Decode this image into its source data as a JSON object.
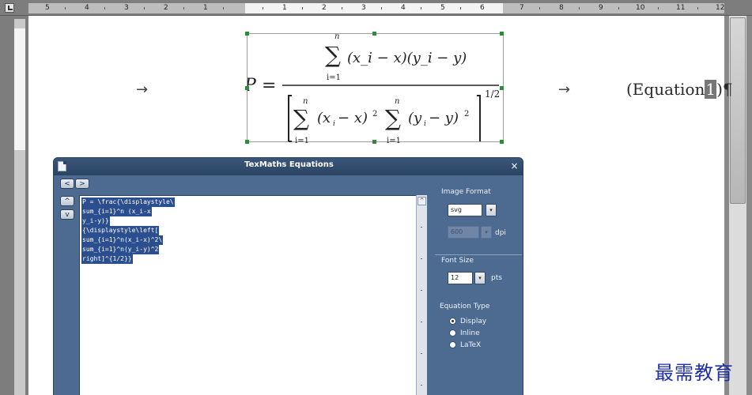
{
  "ruler": {
    "numbers_left": [
      "5",
      "4",
      "3",
      "2",
      "1"
    ],
    "numbers_center": [
      "1",
      "2",
      "3",
      "4",
      "5",
      "6"
    ],
    "numbers_right": [
      "7",
      "8",
      "9",
      "10",
      "11",
      "12"
    ]
  },
  "document": {
    "arrow_symbol": "→",
    "equation_label_prefix": "(Equation",
    "equation_label_number": "1",
    "equation_label_suffix": ")",
    "pilcrow": "¶"
  },
  "equation": {
    "lhs": "P",
    "upper_limit": "n",
    "lower_limit": "i=1",
    "numerator_terms": "(x_i − x)(y_i − y)",
    "exponent": "1/2"
  },
  "dialog": {
    "title": "TexMaths Equations",
    "close_glyph": "×",
    "nav_back_glyph": "<",
    "nav_forward_glyph": ">",
    "nav_up_glyph": "^",
    "nav_down_glyph": "v",
    "code_lines": [
      "P = \\frac{\\displaystyle\\",
      "sum_{i=1}^n (x_i-x",
      "y_i-y)}",
      "{\\displaystyle\\left[",
      "sum_{i=1}^n(x_i-x)^2\\",
      "sum_{i=1}^n(y_i-y)^2",
      "right]^{1/2}}"
    ],
    "image_format": {
      "heading": "Image Format",
      "value": "svg",
      "dpi_value": "600",
      "dpi_unit": "dpi"
    },
    "font_size": {
      "heading": "Font Size",
      "value": "12",
      "unit": "pts"
    },
    "equation_type": {
      "heading": "Equation Type",
      "options": [
        {
          "label": "Display",
          "selected": true
        },
        {
          "label": "Inline",
          "selected": false
        },
        {
          "label": "LaTeX",
          "selected": false
        }
      ]
    }
  },
  "watermark": {
    "text": "最需教育"
  },
  "colors": {
    "dialog_bg": "#4d6a90",
    "titlebar": "#2b4464",
    "selection": "#2b4f8e",
    "handle": "#2f8a3a",
    "watermark": "#1f2fa6"
  }
}
